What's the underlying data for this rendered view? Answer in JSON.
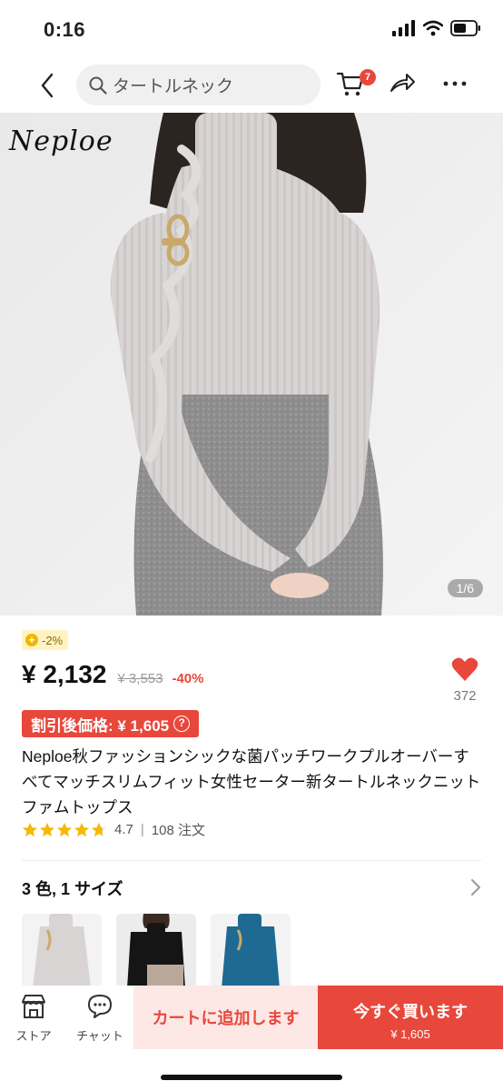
{
  "status_bar": {
    "time": "0:16"
  },
  "header": {
    "search_placeholder": "タートルネック",
    "cart_badge": "7"
  },
  "hero": {
    "brand": "Neploe",
    "image_counter": "1/6"
  },
  "product": {
    "coupon_tag": "-2%",
    "price": "¥ 2,132",
    "original_price": "¥ 3,553",
    "discount_percent": "-40%",
    "wishlist_count": "372",
    "discount_price_label": "割引後価格: ¥ 1,605",
    "title": "Neploe秋ファッションシックな菌パッチワークプルオーバーすべてマッチスリムフィット女性セーター新タートルネックニットファムトップス",
    "rating": "4.7",
    "orders": "108 注文",
    "rating_value": 4.7
  },
  "variants": {
    "label": "3 色, 1 サイズ",
    "swatches": [
      "gray",
      "black",
      "blue"
    ]
  },
  "bottom_bar": {
    "store_label": "ストア",
    "chat_label": "チャット",
    "add_to_cart": "カートに追加します",
    "buy_now": "今すぐ買います",
    "buy_now_price": "¥ 1,605"
  },
  "colors": {
    "accent": "#e8473b",
    "accent_light": "#fde8e6",
    "star": "#f5b800"
  }
}
